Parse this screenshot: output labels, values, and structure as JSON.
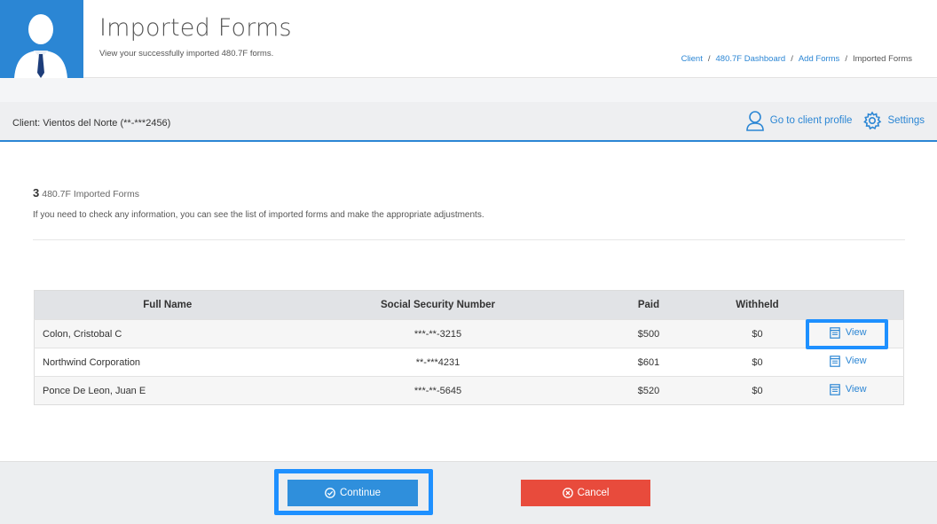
{
  "header": {
    "title": "Imported Forms",
    "subtitle": "View your successfully imported 480.7F forms.",
    "breadcrumb": [
      {
        "label": "Client",
        "link": true
      },
      {
        "label": "480.7F Dashboard",
        "link": true
      },
      {
        "label": "Add Forms",
        "link": true
      },
      {
        "label": "Imported Forms",
        "link": false
      }
    ]
  },
  "client_bar": {
    "label": "Client: Vientos del Norte (**-***2456)",
    "profile_link": "Go to client profile",
    "settings_link": "Settings"
  },
  "summary": {
    "count": "3",
    "count_label": "480.7F Imported Forms",
    "info": "If you need to check any information, you can see the list of imported forms and make the appropriate adjustments."
  },
  "table": {
    "columns": [
      "Full Name",
      "Social Security Number",
      "Paid",
      "Withheld",
      ""
    ],
    "rows": [
      {
        "name": "Colon, Cristobal C",
        "ssn": "***-**-3215",
        "paid": "$500",
        "withheld": "$0",
        "action": "View"
      },
      {
        "name": "Northwind Corporation",
        "ssn": "**-***4231",
        "paid": "$601",
        "withheld": "$0",
        "action": "View"
      },
      {
        "name": "Ponce De Leon, Juan E",
        "ssn": "***-**-5645",
        "paid": "$520",
        "withheld": "$0",
        "action": "View"
      }
    ]
  },
  "footer": {
    "continue_label": "Continue",
    "cancel_label": "Cancel"
  },
  "colors": {
    "accent": "#2b86d4",
    "cancel": "#e84b3c",
    "highlight": "#1e90ff"
  },
  "icons": {
    "avatar": "user-avatar-icon",
    "profile": "user-icon",
    "settings": "gear-icon",
    "view": "form-icon",
    "continue": "check-circle-icon",
    "cancel": "x-circle-icon"
  }
}
